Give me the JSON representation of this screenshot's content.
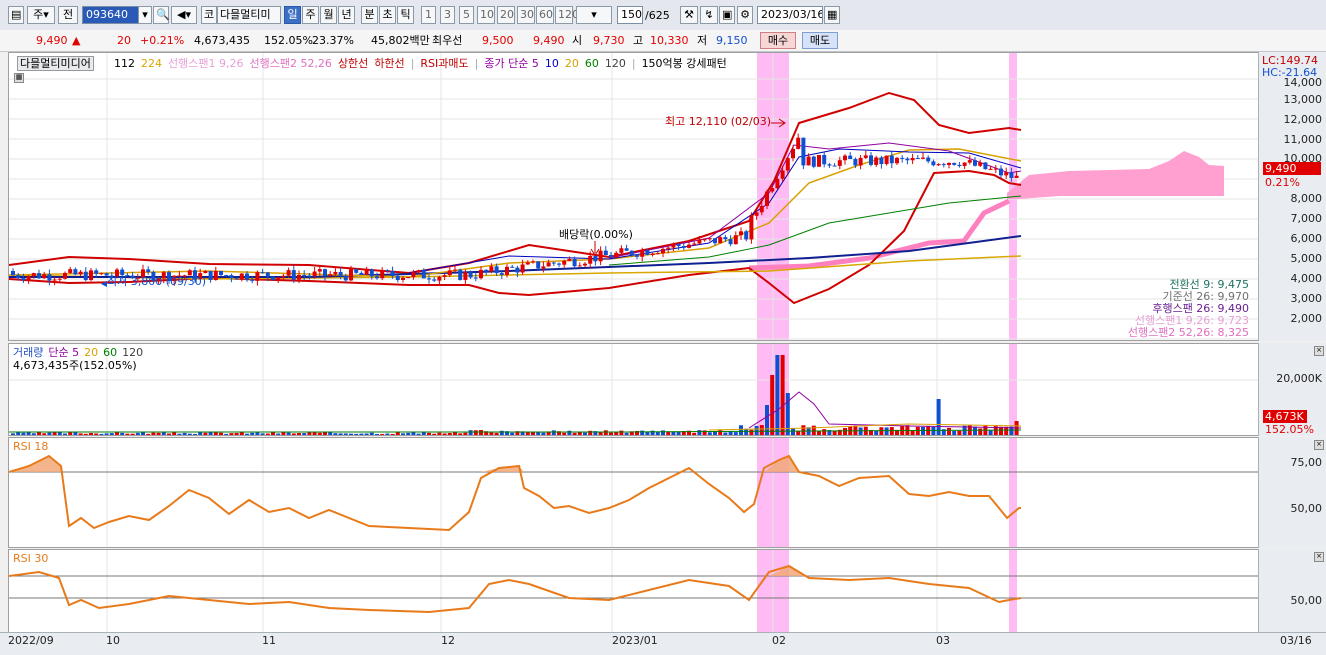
{
  "toolbar": {
    "mode": "주",
    "prev": "전",
    "code": "093640",
    "market": "코",
    "name": "다믈멀티미",
    "periods": [
      "일",
      "주",
      "월",
      "년",
      "분",
      "초",
      "틱"
    ],
    "nums": [
      "1",
      "3",
      "5",
      "10",
      "20",
      "30",
      "60",
      "120"
    ],
    "count": "150",
    "total": "/625",
    "date": "2023/03/16"
  },
  "info": {
    "price": "9,490",
    "change": "20",
    "rate": "+0.21%",
    "volume": "4,673,435",
    "vol_rate": "152.05%",
    "turnover": "23.37%",
    "amount": "45,802백만",
    "best_label": "최우선",
    "ask": "9,500",
    "bid": "9,490",
    "open_label": "시",
    "open": "9,730",
    "high_label": "고",
    "high": "10,330",
    "low_label": "저",
    "low": "9,150",
    "buy_label": "매수",
    "sell_label": "매도"
  },
  "price_panel": {
    "title": "다믈멀티미디어",
    "legend": [
      {
        "text": "112",
        "color": "#000000"
      },
      {
        "text": "224",
        "color": "#d8a800"
      },
      {
        "text": "선행스팬1 9,26",
        "color": "#e6a0d8"
      },
      {
        "text": "선행스팬2 52,26",
        "color": "#e070c0"
      },
      {
        "text": "상한선",
        "color": "#c00000"
      },
      {
        "text": "하한선",
        "color": "#c00000"
      },
      {
        "text": "RSI과매도",
        "color": "#c00000"
      },
      {
        "text": "종가 단순 5",
        "color": "#9000a0"
      },
      {
        "text": "10",
        "color": "#0000c0"
      },
      {
        "text": "20",
        "color": "#d8a000"
      },
      {
        "text": "60",
        "color": "#008000"
      },
      {
        "text": "120",
        "color": "#404040"
      },
      {
        "text": "150억봉 강세패턴",
        "color": "#000000"
      }
    ],
    "annot_high": "최고 12,110 (02/03)",
    "annot_low": "최저 3,800 (09/30)",
    "annot_div": "배당락(0.00%)",
    "lc": "LC:149.74",
    "hc": "HC:-21.64",
    "yticks": [
      "14,000",
      "13,000",
      "12,000",
      "11,000",
      "10,000",
      "9,000",
      "8,000",
      "7,000",
      "6,000",
      "5,000",
      "4,000",
      "3,000",
      "2,000"
    ],
    "cur_price": "9,490",
    "cur_rate": "0.21%",
    "ichimoku": [
      {
        "text": "전환선 9: 9,475",
        "color": "#207060"
      },
      {
        "text": "기준선 26: 9,970",
        "color": "#707070"
      },
      {
        "text": "후행스팬 26: 9,490",
        "color": "#6a2090"
      },
      {
        "text": "선행스팬1 9,26: 9,723",
        "color": "#e6a0d8"
      },
      {
        "text": "선행스팬2 52,26: 8,325",
        "color": "#e070c0"
      }
    ]
  },
  "volume_panel": {
    "legend": [
      {
        "text": "거래량",
        "color": "#2050c0"
      },
      {
        "text": "단순 5",
        "color": "#9000a0"
      },
      {
        "text": "20",
        "color": "#d8a000"
      },
      {
        "text": "60",
        "color": "#008000"
      },
      {
        "text": "120",
        "color": "#404040"
      }
    ],
    "value": "4,673,435주(152.05%)",
    "ytick": "20,000K",
    "tag_vol": "4,673K",
    "tag_rate": "152.05%"
  },
  "rsi18": {
    "label": "RSI 18",
    "y75": "75,00",
    "y50": "50,00"
  },
  "rsi30": {
    "label": "RSI 30",
    "y50": "50,00"
  },
  "xaxis": {
    "labels": [
      "2022/09",
      "10",
      "11",
      "12",
      "2023/01",
      "02",
      "03"
    ],
    "right": "03/16"
  },
  "colors": {
    "up": "#e00000",
    "down": "#1050d0",
    "highlight": "#ff9ef0",
    "rsi": "#e87a1a"
  }
}
